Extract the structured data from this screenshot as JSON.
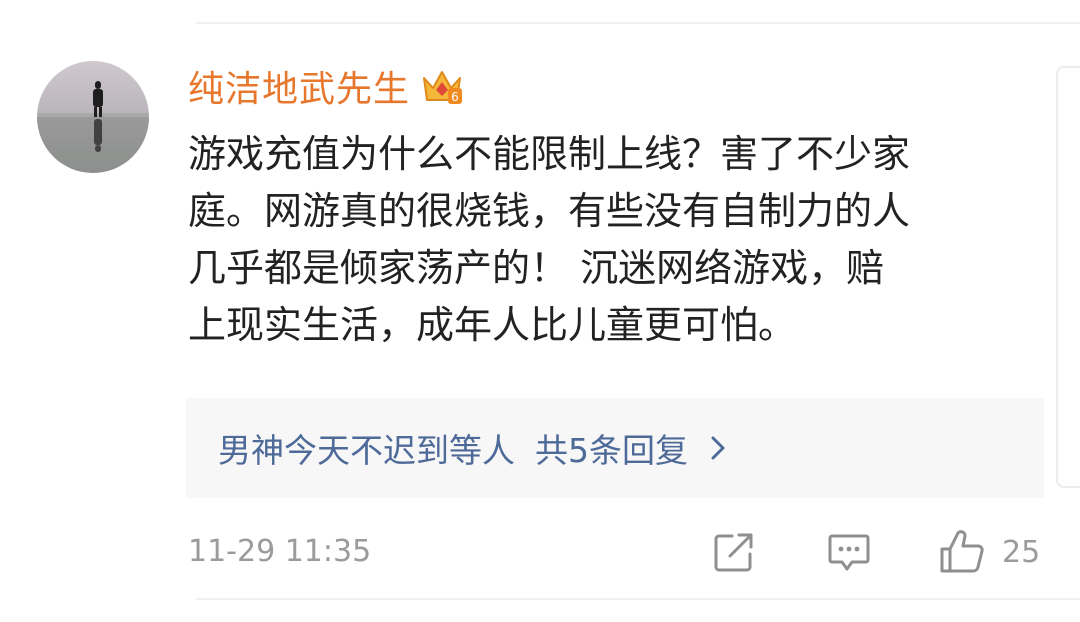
{
  "comment": {
    "username": "纯洁地武先生",
    "vip_level": "6",
    "content_lines": [
      "游戏充值为什么不能限制上线？害了不少家",
      "庭。网游真的很烧钱，有些没有自制力的人",
      "几乎都是倾家荡产的！ 沉迷网络游戏，赔",
      "上现实生活，成年人比儿童更可怕。"
    ],
    "timestamp": "11-29 11:35",
    "like_count": "25"
  },
  "reply_preview": {
    "user": "男神今天不迟到等人",
    "count_text": "共5条回复"
  },
  "colors": {
    "username": "#e8772e",
    "reply_link": "#4e6a98",
    "meta_text": "#9b9b9b",
    "reply_bg": "#f7f7f7"
  },
  "icons": [
    "avatar",
    "vip-crown-icon",
    "chevron-right-icon",
    "share-icon",
    "comment-icon",
    "like-icon"
  ]
}
